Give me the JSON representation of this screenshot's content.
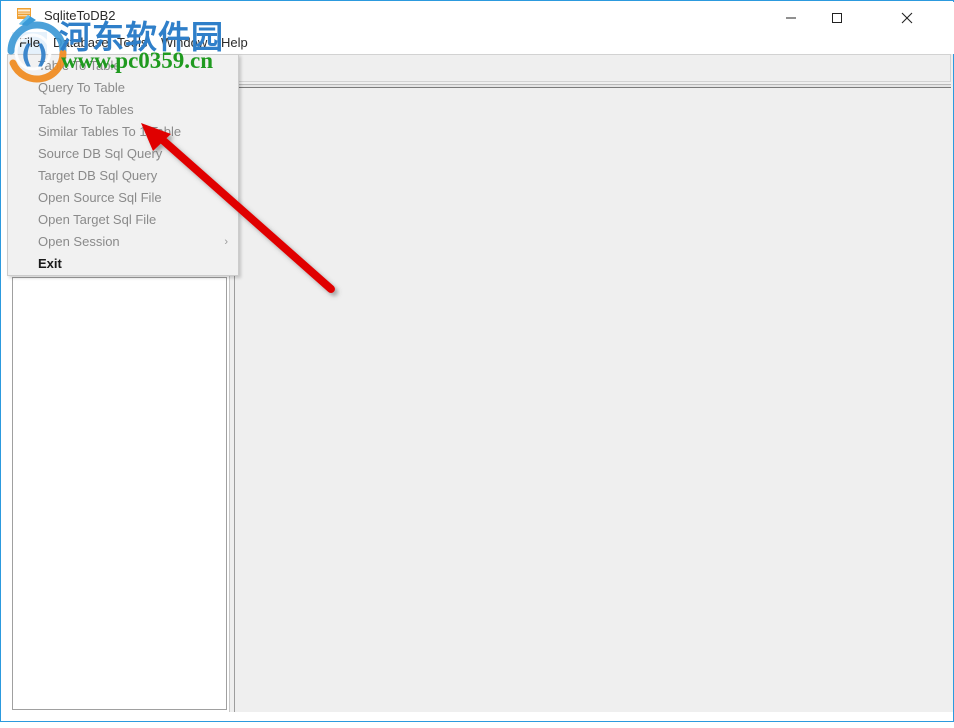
{
  "window": {
    "title": "SqliteToDB2",
    "icon": "app-icon",
    "controls": {
      "minimize_label": "Minimize",
      "maximize_label": "Maximize",
      "close_label": "Close"
    },
    "border_color": "#2c9ade"
  },
  "menu_bar": {
    "items": [
      {
        "label": "File",
        "active": true
      },
      {
        "label": "Database",
        "active": false
      },
      {
        "label": "Tools",
        "active": false
      },
      {
        "label": "Window",
        "active": false
      },
      {
        "label": "Help",
        "active": false
      }
    ]
  },
  "file_menu": {
    "items": [
      {
        "label": "Table To Table",
        "has_submenu": false,
        "emphasis": false
      },
      {
        "label": "Query To Table",
        "has_submenu": false,
        "emphasis": false
      },
      {
        "label": "Tables To Tables",
        "has_submenu": false,
        "emphasis": false
      },
      {
        "label": "Similar Tables To 1 Table",
        "has_submenu": false,
        "emphasis": false
      },
      {
        "label": "Source DB Sql Query",
        "has_submenu": false,
        "emphasis": false
      },
      {
        "label": "Target DB Sql Query",
        "has_submenu": false,
        "emphasis": false
      },
      {
        "label": "Open Source Sql File",
        "has_submenu": false,
        "emphasis": false
      },
      {
        "label": "Open Target Sql File",
        "has_submenu": false,
        "emphasis": false
      },
      {
        "label": "Open Session",
        "has_submenu": true,
        "emphasis": false
      },
      {
        "label": "Exit",
        "has_submenu": false,
        "emphasis": true
      }
    ],
    "submenu_glyph": "›"
  },
  "left_panel": {
    "content": ""
  },
  "workspace": {
    "toolbar_content": "",
    "body_content": ""
  },
  "watermark": {
    "cn_text": "河东软件园",
    "url_text": "www.pc0359.cn",
    "cn_color": "#2f7fc9",
    "url_color": "#1f9a1f"
  },
  "annotation": {
    "arrow_color": "#e00000",
    "points_at": "Similar Tables To 1 Table"
  }
}
